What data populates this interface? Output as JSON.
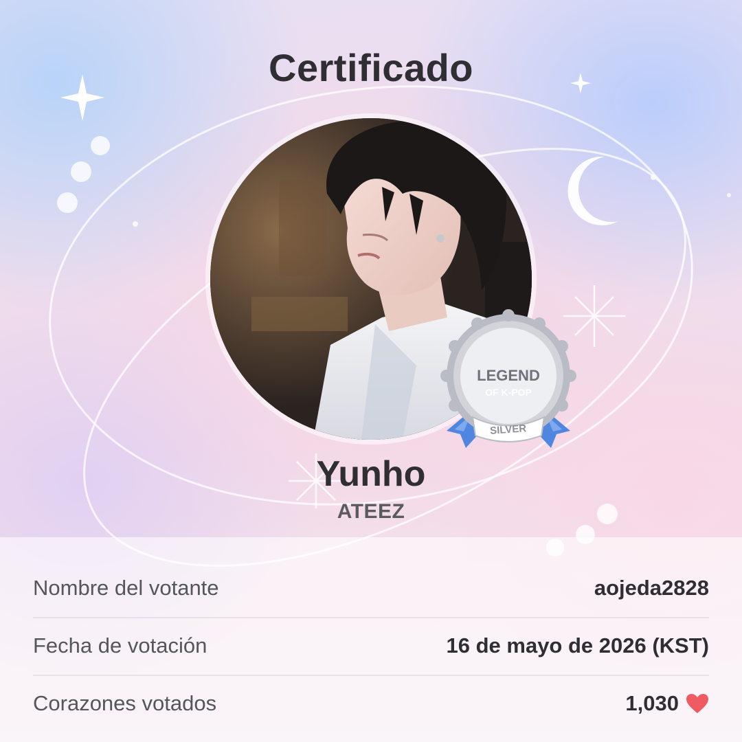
{
  "header": {
    "title": "Certificado"
  },
  "artist": {
    "name": "Yunho",
    "group": "ATEEZ"
  },
  "badge": {
    "line1": "LEGEND",
    "line2": "OF K-POP",
    "tier": "SILVER",
    "icon": "legend-medal-icon"
  },
  "info": {
    "voter_label": "Nombre del votante",
    "voter_value": "aojeda2828",
    "date_label": "Fecha de votación",
    "date_value": "16 de mayo de 2026 (KST)",
    "hearts_label": "Corazones votados",
    "hearts_value": "1,030",
    "hearts_icon": "heart-icon"
  },
  "colors": {
    "heart": "#f05a62",
    "ribbon": "#4f86e0",
    "badge_silver": "#b9bcc4",
    "title_text": "#2e2e33"
  }
}
